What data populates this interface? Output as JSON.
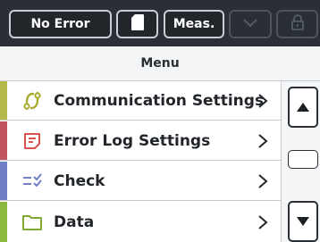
{
  "toolbar": {
    "error_status_label": "No Error",
    "sd_card_icon": "sd-card-icon",
    "meas_label": "Meas.",
    "down_icon": "chevron-down-icon",
    "lock_icon": "lock-icon"
  },
  "menu": {
    "title": "Menu",
    "items": [
      {
        "label": "Communication Settings",
        "icon": "communication-icon",
        "color": "#b5b84a"
      },
      {
        "label": "Error Log Settings",
        "icon": "error-log-icon",
        "color": "#c0545f"
      },
      {
        "label": "Check",
        "icon": "check-list-icon",
        "color": "#6f7fc8"
      },
      {
        "label": "Data",
        "icon": "folder-icon",
        "color": "#8bb83f"
      }
    ]
  },
  "scroll": {
    "up_icon": "arrow-up-icon",
    "down_icon": "arrow-down-icon"
  },
  "colors": {
    "toolbar_bg": "#2a2f35",
    "accent_red": "#d9534f"
  }
}
